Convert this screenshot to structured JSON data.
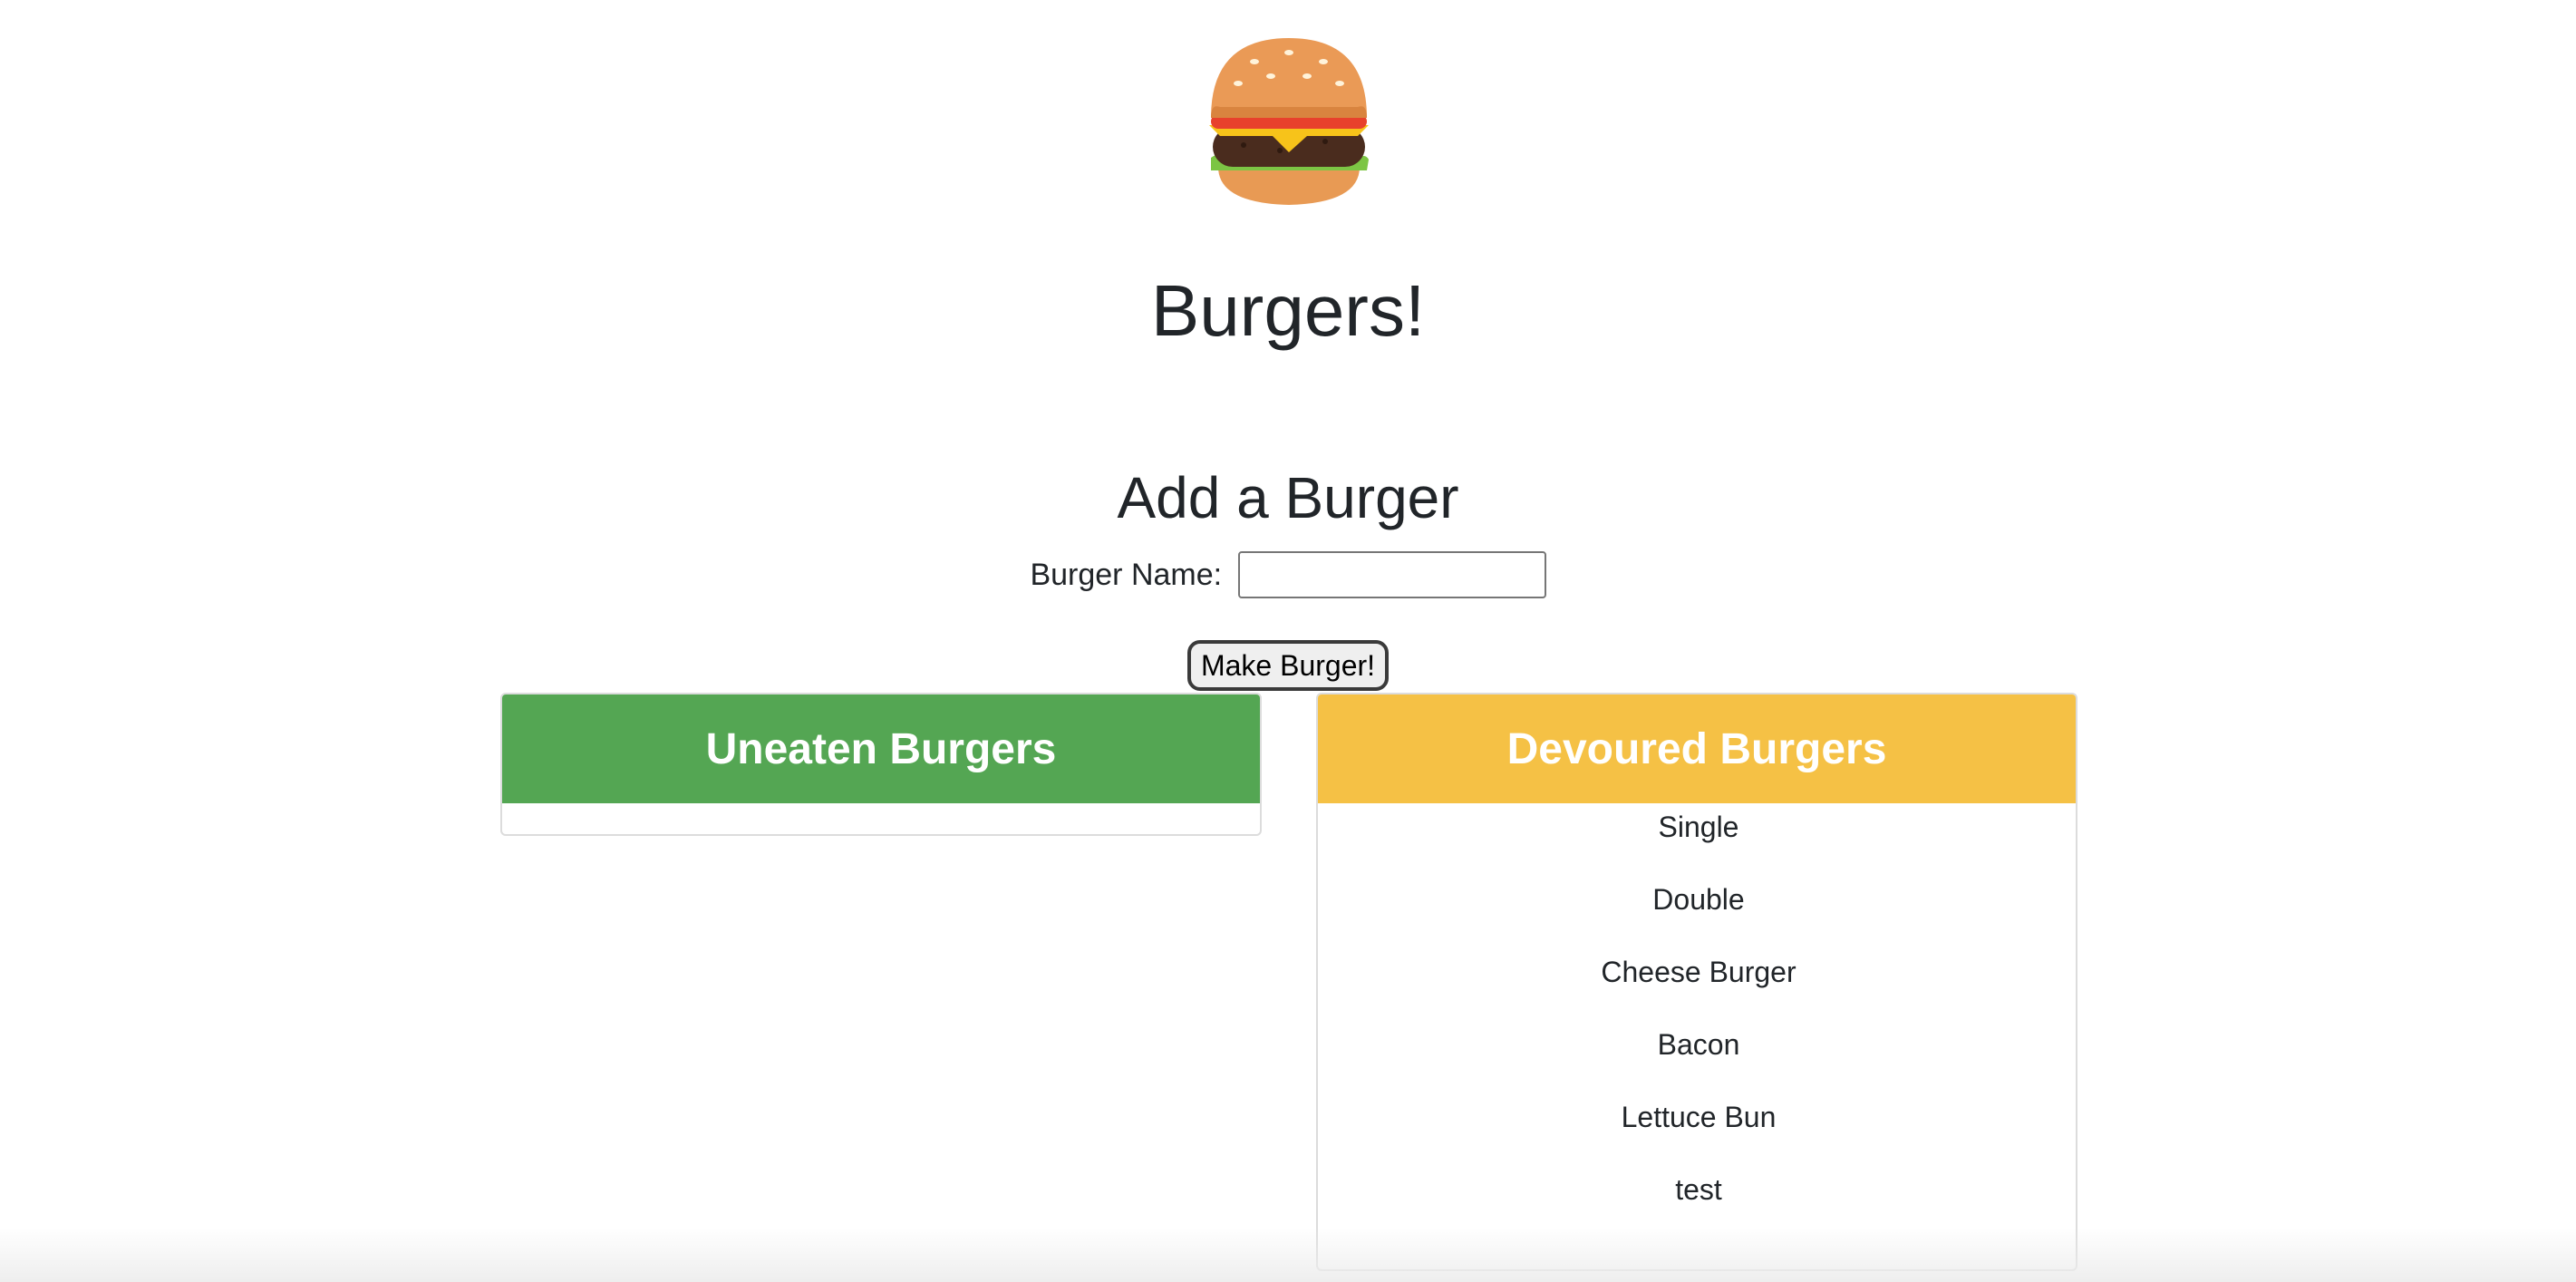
{
  "header": {
    "logo_icon": "hamburger-emoji",
    "title": "Burgers!"
  },
  "form": {
    "heading": "Add a Burger",
    "label": "Burger Name:",
    "input_value": "",
    "submit_label": "Make Burger!"
  },
  "uneaten": {
    "title": "Uneaten Burgers",
    "color": "#54a653",
    "items": []
  },
  "devoured": {
    "title": "Devoured Burgers",
    "color": "#f5c145",
    "items": [
      "Single",
      "Double",
      "Cheese Burger",
      "Bacon",
      "Lettuce Bun",
      "test"
    ]
  }
}
